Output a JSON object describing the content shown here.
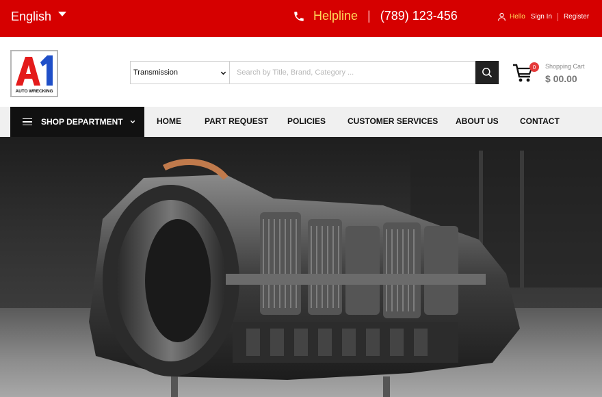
{
  "topbar": {
    "language": "English",
    "helpline_label": "Helpline",
    "helpline_number": "(789) 123-456",
    "hello": "Hello",
    "sign_in": "Sign In",
    "register": "Register"
  },
  "logo": {
    "text": "AUTO WRECKING"
  },
  "search": {
    "category": "Transmission",
    "placeholder": "Search by Title, Brand, Category ..."
  },
  "cart": {
    "label": "Shopping Cart",
    "total": "$ 00.00",
    "count": "0"
  },
  "nav": {
    "department": "SHOP DEPARTMENT",
    "items": [
      "HOME",
      "PART REQUEST",
      "POLICIES",
      "CUSTOMER SERVICES",
      "ABOUT US",
      "CONTACT"
    ]
  },
  "colors": {
    "brand_red": "#d60000",
    "accent_yellow": "#ffd85a",
    "nav_dark": "#111111"
  },
  "icons": [
    "phone-icon",
    "user-icon",
    "search-icon",
    "cart-icon",
    "menu-icon",
    "chevron-down-icon"
  ]
}
